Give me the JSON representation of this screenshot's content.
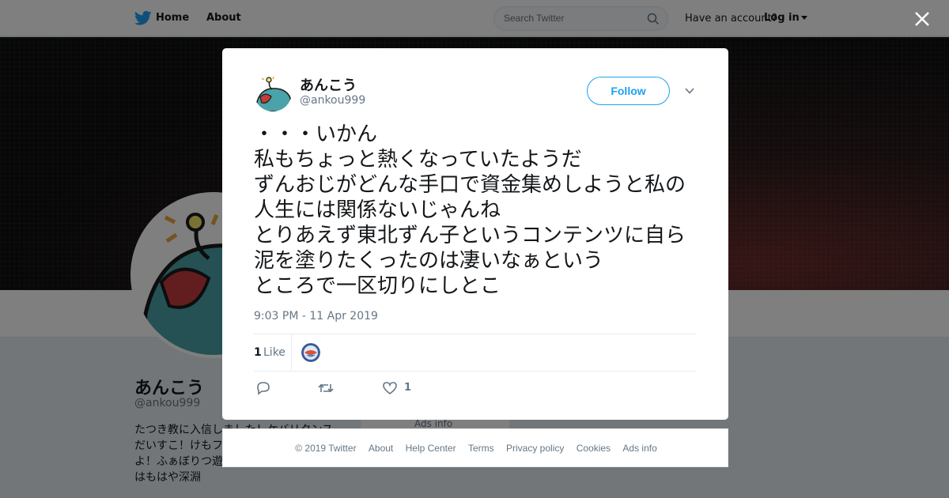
{
  "topbar": {
    "home_label": "Home",
    "about_label": "About",
    "search_placeholder": "Search Twitter",
    "account_question": "Have an account?",
    "login_label": "Log in"
  },
  "profile": {
    "name": "あんこう",
    "handle": "@ankou999",
    "bio_lines": [
      "たつき教に入信しました！ケバリタンス",
      "だいすこ！けもフ",
      "よ！ふぁぼりつ遊",
      "はもはや深淵"
    ],
    "ads_info": "Ads info"
  },
  "tweet": {
    "author_name": "あんこう",
    "author_handle": "@ankou999",
    "follow_label": "Follow",
    "text": "・・・いかん\n私もちょっと熱くなっていたようだ\nずんおじがどんな手口で資金集めしようと私の人生には関係ないじゃんね\nとりあえず東北ずん子というコンテンツに自ら泥を塗りたくったのは凄いなぁという\nところで一区切りにしとこ",
    "timestamp": "9:03 PM - 11 Apr 2019",
    "like_count": "1",
    "like_label": "Like",
    "action_like_count": "1"
  },
  "footer": {
    "copyright": "© 2019 Twitter",
    "links": [
      "About",
      "Help Center",
      "Terms",
      "Privacy policy",
      "Cookies",
      "Ads info"
    ]
  },
  "icons": {
    "bird": "twitter-bird-icon",
    "search": "search-icon",
    "close": "close-icon",
    "caret": "chevron-down-icon",
    "reply": "reply-icon",
    "retweet": "retweet-icon",
    "like": "heart-icon"
  },
  "colors": {
    "brand": "#1da1f2",
    "text": "#14171a",
    "muted": "#657786"
  }
}
